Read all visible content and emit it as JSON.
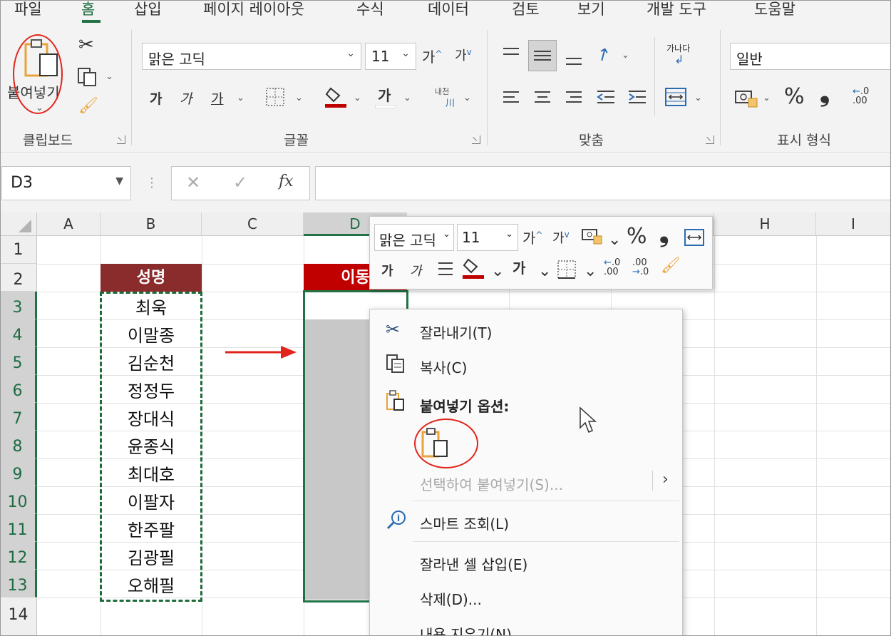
{
  "ribbon": {
    "tabs": [
      "파일",
      "홈",
      "삽입",
      "페이지 레이아웃",
      "수식",
      "데이터",
      "검토",
      "보기",
      "개발 도구",
      "도움말"
    ],
    "active_tab": "홈",
    "clipboard": {
      "paste_label": "붙여넣기",
      "group_label": "클립보드"
    },
    "font": {
      "font_name": "맑은 고딕",
      "font_size": "11",
      "grow_label": "가",
      "shrink_label": "가",
      "bold_label": "가",
      "italic_label": "가",
      "underline_label": "가",
      "font_color_label": "가",
      "phonetic_label": "내천",
      "group_label": "글꼴",
      "fill_color": "#c00000"
    },
    "alignment": {
      "wrap_label": "가나다",
      "group_label": "맞춤"
    },
    "number": {
      "format": "일반",
      "percent": "%",
      "comma": "❟",
      "group_label": "표시 형식"
    }
  },
  "formula_bar": {
    "name_box": "D3",
    "cancel": "✕",
    "enter": "✓",
    "fx": "fx"
  },
  "sheet": {
    "columns": [
      "A",
      "B",
      "C",
      "D",
      "H",
      "I"
    ],
    "rows": [
      "1",
      "2",
      "3",
      "4",
      "5",
      "6",
      "7",
      "8",
      "9",
      "10",
      "11",
      "12",
      "13",
      "14"
    ],
    "header_b": "성명",
    "header_d": "이동",
    "names": [
      "최욱",
      "이말종",
      "김순천",
      "정정두",
      "장대식",
      "윤종식",
      "최대호",
      "이팔자",
      "한주팔",
      "김광필",
      "오해필"
    ],
    "header_fill": "#8b2c2c",
    "header_d_fill": "#c00000"
  },
  "mini_toolbar": {
    "font_name": "맑은 고딕",
    "font_size": "11",
    "grow_label": "가",
    "shrink_label": "가",
    "percent": "%",
    "comma": "❟",
    "bold_label": "가",
    "italic_label": "가",
    "font_color_label": "가"
  },
  "context_menu": {
    "cut": "잘라내기(T)",
    "copy": "복사(C)",
    "paste_options": "붙여넣기 옵션:",
    "paste_special": "선택하여 붙여넣기(S)...",
    "smart_lookup": "스마트 조회(L)",
    "insert_cut_cells": "잘라낸 셀 삽입(E)",
    "delete": "삭제(D)...",
    "clear_contents": "내용 지우기(N)"
  },
  "colors": {
    "excel_green": "#217346",
    "annotation_red": "#e2241b",
    "selection_grey": "#c8c8c8"
  }
}
